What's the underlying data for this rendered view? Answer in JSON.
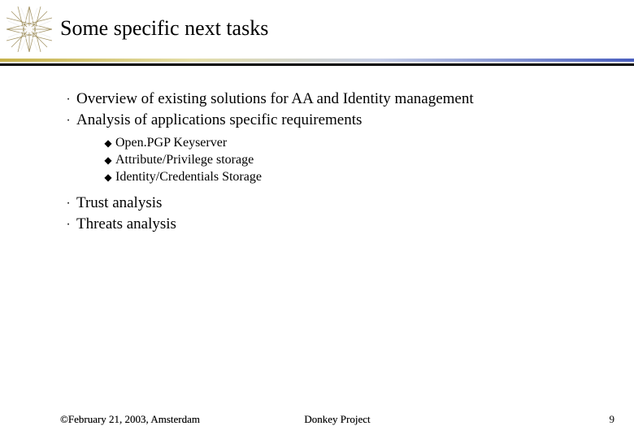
{
  "title": "Some specific next tasks",
  "bullets": [
    {
      "text": "Overview of existing solutions for AA and Identity management",
      "sub": []
    },
    {
      "text": "Analysis of applications specific requirements",
      "sub": [
        "Open.PGP Keyserver",
        "Attribute/Privilege storage",
        "Identity/Credentials Storage"
      ]
    },
    {
      "text": "Trust analysis",
      "sub": []
    },
    {
      "text": "Threats analysis",
      "sub": []
    }
  ],
  "footer": {
    "left": "©February 21, 2003, Amsterdam",
    "center": "Donkey Project",
    "page": "9"
  },
  "icons": {
    "bullet_main": "·",
    "bullet_sub": "◆"
  }
}
